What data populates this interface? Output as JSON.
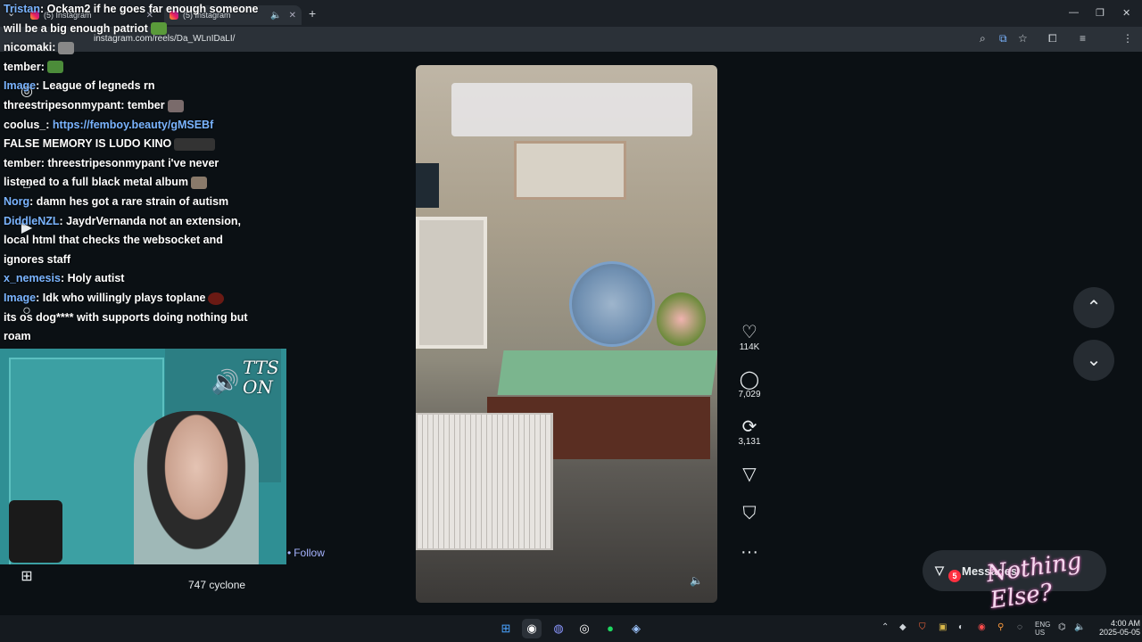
{
  "browser": {
    "tabs": [
      {
        "title": "(5) Instagram",
        "active": false
      },
      {
        "title": "(5) Instagram",
        "active": true
      }
    ],
    "new_tab": "+",
    "url": "instagram.com/reels/Da_WLnIDaLI/",
    "window_controls": [
      "—",
      "❐",
      "✕"
    ]
  },
  "reel": {
    "likes": "114K",
    "comments": "7,029",
    "reposts": "3,131",
    "more": "···"
  },
  "messages": {
    "label": "Messages",
    "badge": "5"
  },
  "overlay": {
    "brand_text": "Nothing Else?"
  },
  "stream": {
    "chat": [
      {
        "user": "Tristan",
        "user_color": "blue",
        "text": ": Ockam2 if he goes far enough someone will be a big enough patriot"
      },
      {
        "user": "nicomaki",
        "user_color": "white",
        "text": ":"
      },
      {
        "user": "tember",
        "user_color": "white",
        "text": ":"
      },
      {
        "user": "Image",
        "user_color": "blue",
        "text": ": League of legneds rn"
      },
      {
        "user": "threestripesonmypant",
        "user_color": "white",
        "text": ": tember"
      },
      {
        "user": "coolus_",
        "user_color": "white",
        "text": ":",
        "link": "https://femboy.beauty/gMSEBf"
      },
      {
        "user": "",
        "user_color": "white",
        "text": "FALSE MEMORY IS LUDO KINO"
      },
      {
        "user": "tember",
        "user_color": "white",
        "text": ": threestripesonmypant i've never listened to a full black metal album"
      },
      {
        "user": "Norg",
        "user_color": "blue",
        "text": ": damn hes got a rare strain of autism"
      },
      {
        "user": "DiddleNZL",
        "user_color": "blue",
        "text": ": JaydrVernanda not an extension, local html that checks the websocket and ignores staff"
      },
      {
        "user": "x_nemesis",
        "user_color": "blue",
        "text": ": Holy autist"
      },
      {
        "user": "Image",
        "user_color": "blue",
        "text": ": Idk who willingly plays toplane"
      },
      {
        "user": "",
        "user_color": "white",
        "text": "its os dog**** with supports doing nothing but roam"
      }
    ],
    "cam_text": "TTS ON",
    "follow": "Follow",
    "channel_label": "747 cyclone"
  },
  "taskbar": {
    "apps": [
      "windows",
      "chrome",
      "discord",
      "obs",
      "spotify",
      "steam"
    ],
    "tray_lang": "ENG US",
    "clock_time": "4:00 AM",
    "clock_date": "2025-05-05"
  },
  "colors": {
    "background": "#0b1014",
    "chat_user_blue": "#7ab4ff",
    "follow": "#a7b4ff",
    "badge": "#ff3040"
  }
}
